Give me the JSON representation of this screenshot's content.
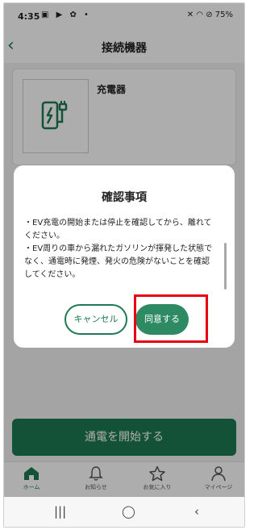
{
  "status_bar": {
    "time": "4:35",
    "left_icons": "▣ ▶ ✿ •",
    "right_icons": "✕ ◠ ⊘ 75%",
    "battery": "75%"
  },
  "header": {
    "back_icon": "‹",
    "title": "接続機器"
  },
  "device": {
    "name": "充電器",
    "icon": "ev-charger-icon"
  },
  "main": {
    "start_button_label": "通電を開始する"
  },
  "dialog": {
    "title": "確認事項",
    "line1": "・EV充電の開始または停止を確認してから、離れてください。",
    "line2": "・EV周りの車から漏れたガソリンが揮発した状態でなく、通電時に発煙、発火の危険がないことを確認してください。",
    "cancel_label": "キャンセル",
    "agree_label": "同意する",
    "highlight_color": "#e60012"
  },
  "tabbar": {
    "items": [
      {
        "label": "ホーム",
        "icon": "home-icon",
        "active": true
      },
      {
        "label": "お知らせ",
        "icon": "bell-icon",
        "active": false
      },
      {
        "label": "お気に入り",
        "icon": "star-icon",
        "active": false
      },
      {
        "label": "マイページ",
        "icon": "person-icon",
        "active": false
      }
    ]
  },
  "system_nav": {
    "recents": "|||",
    "home": "◯",
    "back": "‹"
  },
  "colors": {
    "accent": "#1e7a52",
    "overlay": "rgba(0,0,0,0.32)"
  }
}
